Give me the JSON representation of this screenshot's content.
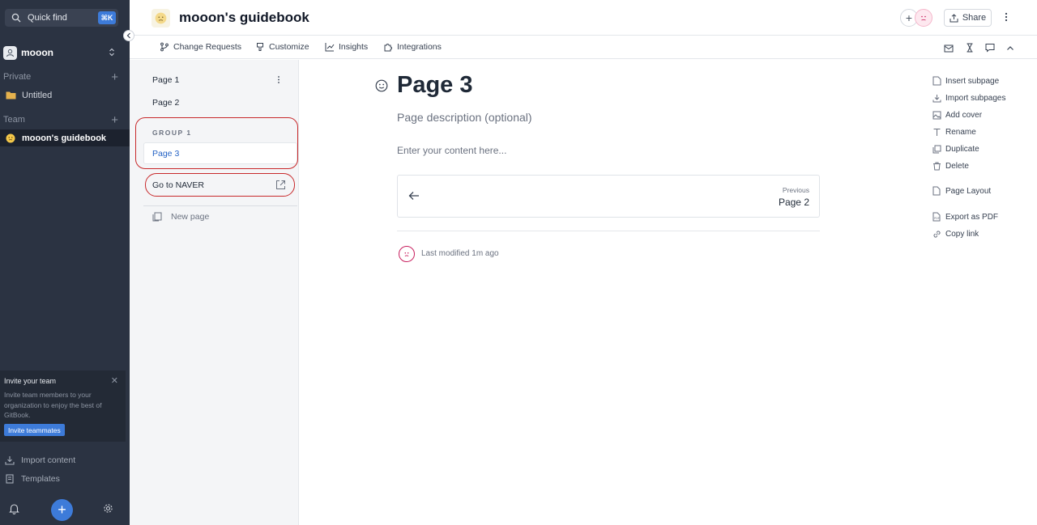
{
  "sidebar": {
    "quick_find": {
      "label": "Quick find",
      "shortcut": "⌘K"
    },
    "org": {
      "name": "mooon"
    },
    "private": {
      "label": "Private",
      "items": [
        {
          "label": "Untitled",
          "icon": "folder-icon"
        }
      ]
    },
    "team": {
      "label": "Team",
      "items": [
        {
          "label": "mooon's guidebook",
          "icon": "smiley-emoji-icon",
          "active": true
        }
      ]
    },
    "invite": {
      "title": "Invite your team",
      "description": "Invite team members to your organization to enjoy the best of GitBook.",
      "button": "Invite teammates"
    },
    "bottom_items": [
      {
        "label": "Import content",
        "icon": "import-icon"
      },
      {
        "label": "Templates",
        "icon": "templates-icon"
      }
    ]
  },
  "header": {
    "title": "mooon's guidebook",
    "share": "Share"
  },
  "toolbar": {
    "items": [
      {
        "label": "Change Requests",
        "icon": "branch-icon"
      },
      {
        "label": "Customize",
        "icon": "brush-icon"
      },
      {
        "label": "Insights",
        "icon": "chart-icon"
      },
      {
        "label": "Integrations",
        "icon": "puzzle-icon"
      }
    ]
  },
  "tree": {
    "pages": [
      {
        "label": "Page 1"
      },
      {
        "label": "Page 2"
      }
    ],
    "group": {
      "label": "GROUP 1",
      "items": [
        {
          "label": "Page 3",
          "selected": true
        }
      ]
    },
    "link": {
      "label": "Go to NAVER"
    },
    "new_page": "New page"
  },
  "page": {
    "title": "Page 3",
    "description_placeholder": "Page description (optional)",
    "content_placeholder": "Enter your content here...",
    "previous": {
      "label": "Previous",
      "title": "Page 2"
    },
    "last_modified": "Last modified 1m ago"
  },
  "actions": {
    "items": [
      {
        "label": "Insert subpage",
        "icon": "insert-subpage-icon"
      },
      {
        "label": "Import subpages",
        "icon": "import-icon"
      },
      {
        "label": "Add cover",
        "icon": "image-icon"
      },
      {
        "label": "Rename",
        "icon": "text-icon"
      },
      {
        "label": "Duplicate",
        "icon": "duplicate-icon"
      },
      {
        "label": "Delete",
        "icon": "trash-icon"
      },
      {
        "label": "Page Layout",
        "icon": "page-icon"
      },
      {
        "label": "Export as PDF",
        "icon": "pdf-icon"
      },
      {
        "label": "Copy link",
        "icon": "link-icon"
      }
    ]
  },
  "colors": {
    "accent": "#3d7bd9",
    "sidebar_bg": "#2b3342",
    "highlight": "#c8292b",
    "selected_text": "#2563c5"
  }
}
